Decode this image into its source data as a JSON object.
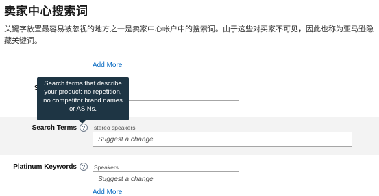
{
  "page": {
    "title": "卖家中心搜索词",
    "intro": "关键字放置最容易被忽视的地方之一是卖家中心帐户中的搜索词。由于这些对买家不可见，因此也称为亚马逊隐藏关键词。"
  },
  "top_section": {
    "add_more_label": "Add More",
    "partial_field_label": "S"
  },
  "tooltip": {
    "text": "Search terms that describe your product: no repetition, no competitor brand names or ASINs."
  },
  "search_terms": {
    "label": "Search Terms",
    "help_icon": "question-circle-icon",
    "current_value": "stereo speakers",
    "placeholder": "Suggest a change"
  },
  "platinum_keywords": {
    "label": "Platinum Keywords",
    "help_icon": "question-circle-icon",
    "current_value": "Speakers",
    "placeholder": "Suggest a change",
    "add_more_label": "Add More"
  },
  "colors": {
    "link": "#0066c0",
    "tooltip_bg": "#1e3544",
    "band_bg": "#f3f3f3"
  }
}
